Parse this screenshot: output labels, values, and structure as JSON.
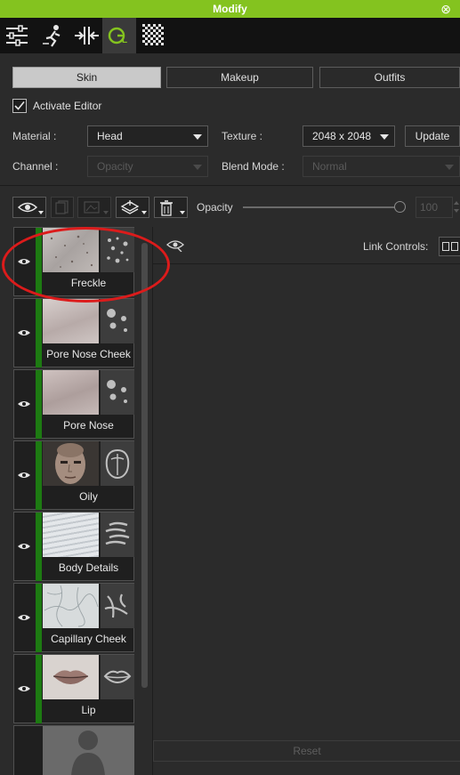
{
  "window": {
    "title": "Modify",
    "close_icon": "close-icon"
  },
  "toolbar": {
    "buttons": [
      {
        "name": "sliders-icon",
        "active": false
      },
      {
        "name": "motion-icon",
        "active": false
      },
      {
        "name": "transform-icon",
        "active": false
      },
      {
        "name": "gl-material-icon",
        "active": true
      },
      {
        "name": "checker-icon",
        "active": false
      }
    ]
  },
  "tabs": [
    {
      "label": "Skin",
      "active": true
    },
    {
      "label": "Makeup",
      "active": false
    },
    {
      "label": "Outfits",
      "active": false
    }
  ],
  "activate_editor": {
    "label": "Activate Editor",
    "checked": true
  },
  "material": {
    "label": "Material :",
    "value": "Head"
  },
  "texture": {
    "label": "Texture :",
    "value": "2048 x 2048"
  },
  "update_label": "Update",
  "channel": {
    "label": "Channel :",
    "value": "Opacity"
  },
  "blend_mode": {
    "label": "Blend Mode :",
    "value": "Normal"
  },
  "opacity": {
    "label": "Opacity",
    "value": "100",
    "slider": 1.0
  },
  "layers": [
    {
      "name": "Freckle",
      "texture": "freckle",
      "icon": "dots-icon",
      "bar_color": "#1d7a12"
    },
    {
      "name": "Pore Nose Cheek",
      "texture": "pore",
      "icon": "dots-icon",
      "bar_color": "#1d7a12"
    },
    {
      "name": "Pore Nose",
      "texture": "pore",
      "icon": "dots-icon",
      "bar_color": "#1d7a12"
    },
    {
      "name": "Oily",
      "texture": "face",
      "icon": "head-mask-icon",
      "bar_color": "#1d7a12"
    },
    {
      "name": "Body Details",
      "texture": "body",
      "icon": "waves-icon",
      "bar_color": "#1d7a12"
    },
    {
      "name": "Capillary Cheek",
      "texture": "capillary",
      "icon": "vein-icon",
      "bar_color": "#1d7a12"
    },
    {
      "name": "Lip",
      "texture": "lip",
      "icon": "lips-icon",
      "bar_color": "#1d7a12"
    }
  ],
  "link_controls": {
    "label": "Link Controls:"
  },
  "reset_label": "Reset",
  "colors": {
    "accent": "#84c31f",
    "layer_bar": "#1d7a12",
    "highlight_circle": "#dc1b1b"
  }
}
